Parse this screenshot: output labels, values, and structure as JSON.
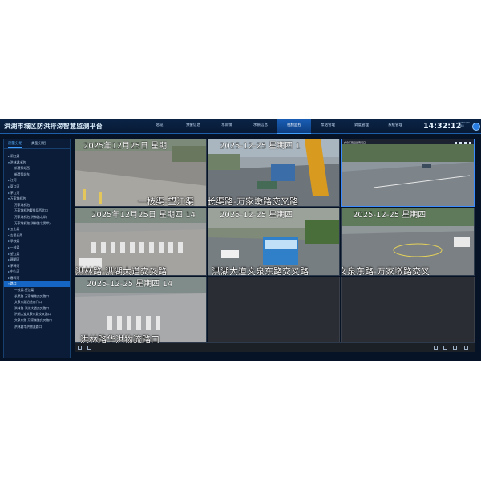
{
  "header": {
    "app_title": "洪湖市城区防洪排涝智慧监测平台",
    "nav": [
      "总览",
      "预警信息",
      "水雨情",
      "水质信息",
      "视频监控",
      "泵站管理",
      "调度管理",
      "系统管理"
    ],
    "active_nav": "视频监控",
    "clock": "14:32:12",
    "date_line1": "2025/12/25",
    "date_line2": "星期四"
  },
  "sidebar": {
    "tabs": [
      "测量分组",
      "类型分组"
    ],
    "tree": [
      {
        "label": "洞江渠",
        "expanded": false,
        "indent": 1,
        "arrow": true
      },
      {
        "label": "洪林湖水泡",
        "expanded": true,
        "indent": 1,
        "arrow": true
      },
      {
        "label": "新堤泵站西",
        "indent": 2,
        "arrow": false
      },
      {
        "label": "新堤泵站东",
        "indent": 2,
        "arrow": false
      },
      {
        "label": "江河",
        "expanded": false,
        "indent": 1,
        "arrow": true
      },
      {
        "label": "夏口河",
        "expanded": false,
        "indent": 1,
        "arrow": true
      },
      {
        "label": "茅江河",
        "expanded": false,
        "indent": 1,
        "arrow": true
      },
      {
        "label": "万家墩机泡",
        "expanded": true,
        "indent": 1,
        "arrow": true
      },
      {
        "label": "万家墩机泡",
        "indent": 2,
        "arrow": false
      },
      {
        "label": "万家墩机泡奢排层西北口",
        "indent": 2,
        "arrow": false
      },
      {
        "label": "万家墩机泡(洪林路北岸)",
        "indent": 2,
        "arrow": false
      },
      {
        "label": "万家墩机泡(洪林路北男岸)",
        "indent": 2,
        "arrow": false
      },
      {
        "label": "五七渠",
        "expanded": false,
        "indent": 1,
        "arrow": true
      },
      {
        "label": "吉里长渠",
        "expanded": false,
        "indent": 1,
        "arrow": true
      },
      {
        "label": "季秧渠",
        "expanded": false,
        "indent": 1,
        "arrow": true
      },
      {
        "label": "一枝渠",
        "expanded": false,
        "indent": 1,
        "arrow": true
      },
      {
        "label": "望江渠",
        "expanded": false,
        "indent": 1,
        "arrow": true
      },
      {
        "label": "珊瑚河",
        "expanded": false,
        "indent": 1,
        "arrow": true
      },
      {
        "label": "茅埠河",
        "expanded": false,
        "indent": 1,
        "arrow": true
      },
      {
        "label": "中心河",
        "expanded": false,
        "indent": 1,
        "arrow": true
      },
      {
        "label": "春晖河",
        "expanded": false,
        "indent": 1,
        "arrow": true
      },
      {
        "label": "路口",
        "expanded": true,
        "indent": 1,
        "arrow": true,
        "selected": true
      },
      {
        "label": "一枝渠-望江渠",
        "indent": 2,
        "arrow": false
      },
      {
        "label": "长渠路-万家墩路交叉路口",
        "indent": 2,
        "arrow": false
      },
      {
        "label": "文泉东路沿途南门口",
        "indent": 2,
        "arrow": false
      },
      {
        "label": "洪林路-洪湖大道交叉路口",
        "indent": 2,
        "arrow": false
      },
      {
        "label": "洪湖大道文泉东路交叉路口",
        "indent": 2,
        "arrow": false
      },
      {
        "label": "文泉东路-万家墩路交叉路口",
        "indent": 2,
        "arrow": false
      },
      {
        "label": "洪林路华洪物流路口",
        "indent": 2,
        "arrow": false
      }
    ]
  },
  "tiles": [
    {
      "title": "",
      "date": "2025年12月25日 星期",
      "location": ""
    },
    {
      "title": "",
      "date": "2025-12-25 星期四 1",
      "location": ""
    },
    {
      "title": "文泉东路沿途南门口",
      "date": "",
      "location": ""
    },
    {
      "title": "",
      "date": "",
      "location": "一枝渠-望江渠"
    },
    {
      "title": "",
      "date": "",
      "location": "长渠路-万家墩路交叉路口"
    },
    {
      "title": "",
      "date": "2025-12-25",
      "location": ""
    },
    {
      "title": "",
      "date": "2025年12月25日 星期四 14",
      "location": "洪林路-洪湖大道交叉路口"
    },
    {
      "title": "",
      "date": "2025-12-25 星期四",
      "location": "洪湖大道文泉东路交叉路口"
    },
    {
      "title": "",
      "date": "",
      "location": "文泉东路-万家墩路交叉路口"
    },
    {
      "title": "",
      "date": "2025-12-25 星期四 14",
      "location": "洪林路华洪物流路口"
    },
    {
      "title": "",
      "date": "",
      "location": ""
    },
    {
      "title": "",
      "date": "",
      "location": ""
    }
  ],
  "osd_texts": {
    "r1_loc_a": "一枝渠-望江渠",
    "r1_loc_b": "长渠路-万家墩路交叉路",
    "r2_date_a": "2025年12月25日 星期四 14",
    "r2_date_b": "2025-12-25 星期四",
    "r2_date_c": "2025-12-25 星期四",
    "r2_loc_a": "洪林路-洪湖大道交叉路",
    "r2_loc_b": "洪湖大道文泉东路交叉路",
    "r2_loc_c": "文泉东路-万家墩路交叉",
    "r3_date": "2025-12-25 星期四 14",
    "r3_loc": "洪林路华洪物流路口",
    "r1_date_a": "2025年12月25日 星期",
    "r1_date_b": "2025-12-25 星期四 1"
  },
  "colors": {
    "header_bg": "#0a2446",
    "accent": "#1565c4",
    "app_bg": "#061327"
  }
}
